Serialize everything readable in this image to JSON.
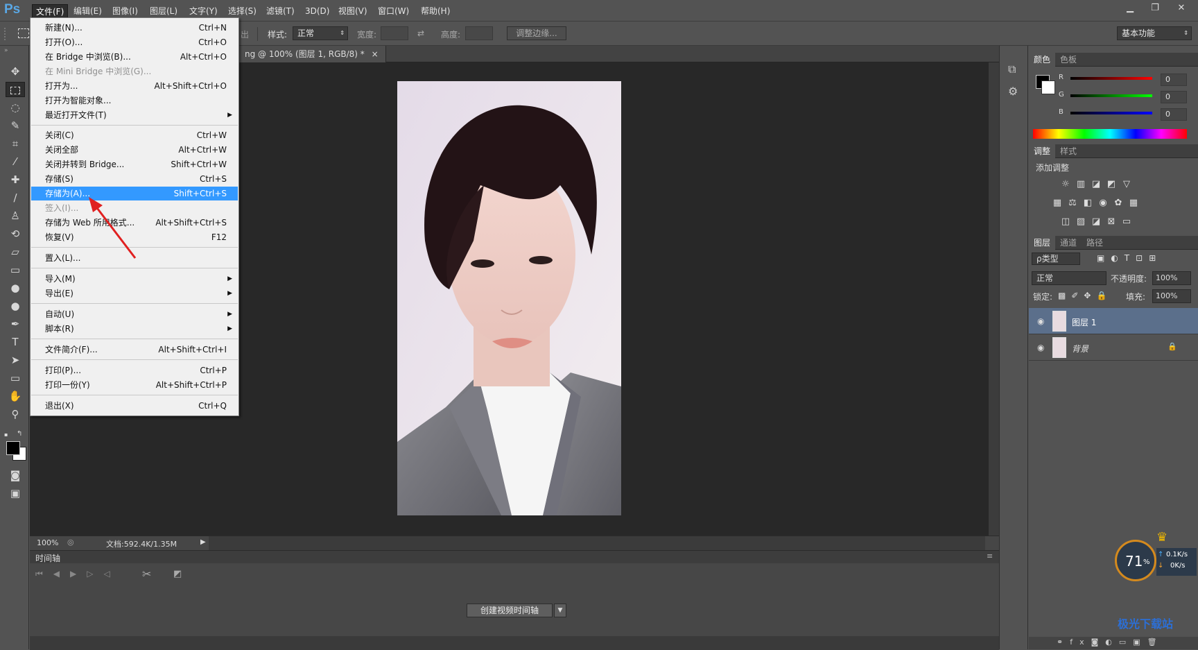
{
  "app": {
    "logo": "Ps"
  },
  "menubar": {
    "items": [
      "文件(F)",
      "编辑(E)",
      "图像(I)",
      "图层(L)",
      "文字(Y)",
      "选择(S)",
      "滤镜(T)",
      "3D(D)",
      "视图(V)",
      "窗口(W)",
      "帮助(H)"
    ],
    "window_buttons": [
      "▁",
      "❐",
      "✕"
    ]
  },
  "options": {
    "style_label": "样式:",
    "style_value": "正常",
    "width_label": "宽度:",
    "height_label": "高度:",
    "refine_edge": "调整边缘...",
    "workspace": "基本功能",
    "partial_text": "出"
  },
  "document": {
    "tab_title": "ng @ 100% (图层 1, RGB/8) *",
    "tab_close": "×"
  },
  "statusbar": {
    "zoom": "100%",
    "doc_info": "文档:592.4K/1.35M"
  },
  "timeline": {
    "title": "时间轴",
    "create_button": "创建视频时间轴"
  },
  "file_menu": {
    "items": [
      {
        "label": "新建(N)...",
        "shortcut": "Ctrl+N"
      },
      {
        "label": "打开(O)...",
        "shortcut": "Ctrl+O"
      },
      {
        "label": "在 Bridge 中浏览(B)...",
        "shortcut": "Alt+Ctrl+O"
      },
      {
        "label": "在 Mini Bridge 中浏览(G)...",
        "shortcut": ""
      },
      {
        "label": "打开为...",
        "shortcut": "Alt+Shift+Ctrl+O"
      },
      {
        "label": "打开为智能对象...",
        "shortcut": ""
      },
      {
        "label": "最近打开文件(T)",
        "shortcut": ""
      },
      {
        "label": "关闭(C)",
        "shortcut": "Ctrl+W"
      },
      {
        "label": "关闭全部",
        "shortcut": "Alt+Ctrl+W"
      },
      {
        "label": "关闭并转到 Bridge...",
        "shortcut": "Shift+Ctrl+W"
      },
      {
        "label": "存储(S)",
        "shortcut": "Ctrl+S"
      },
      {
        "label": "存储为(A)...",
        "shortcut": "Shift+Ctrl+S"
      },
      {
        "label": "签入(I)...",
        "shortcut": ""
      },
      {
        "label": "存储为 Web 所用格式...",
        "shortcut": "Alt+Shift+Ctrl+S"
      },
      {
        "label": "恢复(V)",
        "shortcut": "F12"
      },
      {
        "label": "置入(L)...",
        "shortcut": ""
      },
      {
        "label": "导入(M)",
        "shortcut": ""
      },
      {
        "label": "导出(E)",
        "shortcut": ""
      },
      {
        "label": "自动(U)",
        "shortcut": ""
      },
      {
        "label": "脚本(R)",
        "shortcut": ""
      },
      {
        "label": "文件简介(F)...",
        "shortcut": "Alt+Shift+Ctrl+I"
      },
      {
        "label": "打印(P)...",
        "shortcut": "Ctrl+P"
      },
      {
        "label": "打印一份(Y)",
        "shortcut": "Alt+Shift+Ctrl+P"
      },
      {
        "label": "退出(X)",
        "shortcut": "Ctrl+Q"
      }
    ]
  },
  "color_panel": {
    "tabs": [
      "颜色",
      "色板"
    ],
    "channels": [
      {
        "name": "R",
        "value": "0"
      },
      {
        "name": "G",
        "value": "0"
      },
      {
        "name": "B",
        "value": "0"
      }
    ]
  },
  "adjust_panel": {
    "tabs": [
      "调整",
      "样式"
    ],
    "title": "添加调整"
  },
  "layers_panel": {
    "tabs": [
      "图层",
      "通道",
      "路径"
    ],
    "filter_kind": "ρ类型",
    "blend_mode": "正常",
    "opacity_label": "不透明度:",
    "opacity": "100%",
    "lock_label": "锁定:",
    "fill_label": "填充:",
    "fill": "100%",
    "layers": [
      {
        "name": "图层 1"
      },
      {
        "name": "背景"
      }
    ]
  },
  "overlay": {
    "cpu": "71",
    "cpu_unit": "%",
    "up_speed": "0.1K/s",
    "down_speed": "0K/s",
    "watermark": "极光下载站"
  },
  "colors": {
    "menu_highlight": "#3399ff",
    "annotation_arrow": "#e02020",
    "app_bg": "#535353",
    "canvas_bg": "#282828"
  }
}
